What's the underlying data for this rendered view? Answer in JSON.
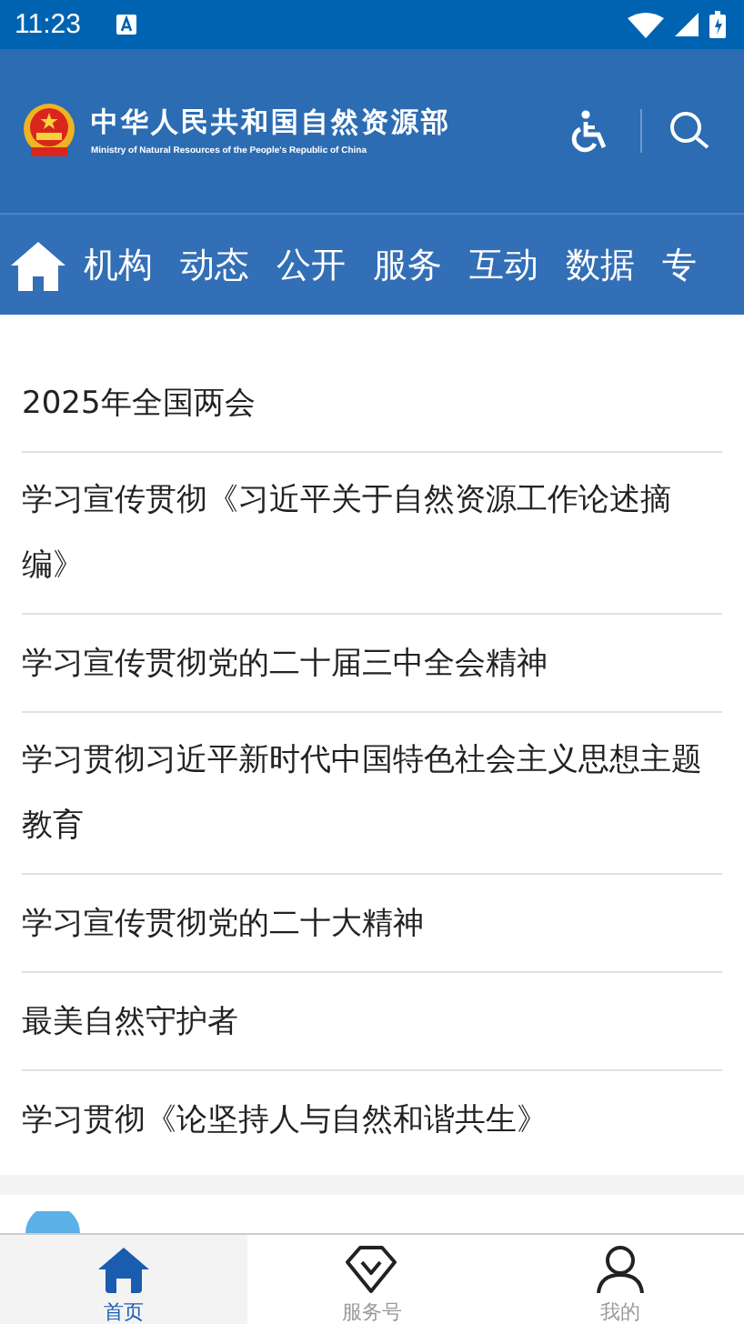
{
  "status_bar": {
    "time": "11:23"
  },
  "header": {
    "title": "中华人民共和国自然资源部",
    "subtitle": "Ministry of Natural Resources of the People's Republic of China"
  },
  "nav": {
    "tabs": [
      "机构",
      "动态",
      "公开",
      "服务",
      "互动",
      "数据",
      "专"
    ]
  },
  "list": [
    "2025年全国两会",
    "学习宣传贯彻《习近平关于自然资源工作论述摘编》",
    "学习宣传贯彻党的二十届三中全会精神",
    "学习贯彻习近平新时代中国特色社会主义思想主题教育",
    "学习宣传贯彻党的二十大精神",
    "最美自然守护者",
    "学习贯彻《论坚持人与自然和谐共生》"
  ],
  "bottom_nav": [
    {
      "label": "首页",
      "kind": "home",
      "selected": true
    },
    {
      "label": "服务号",
      "kind": "diamond",
      "selected": false
    },
    {
      "label": "我的",
      "kind": "person",
      "selected": false
    }
  ]
}
